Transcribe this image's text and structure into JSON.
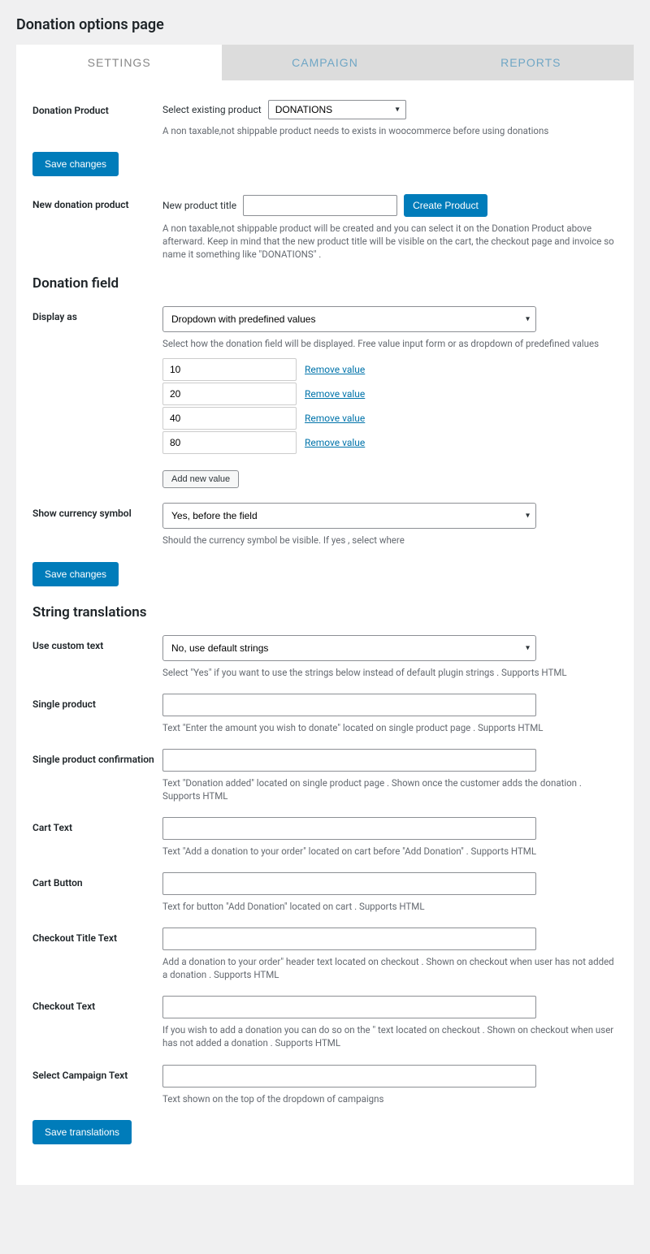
{
  "page_title": "Donation options page",
  "tabs": {
    "settings": "SETTINGS",
    "campaign": "CAMPAIGN",
    "reports": "REPORTS"
  },
  "donation_product": {
    "label": "Donation Product",
    "select_label": "Select existing product",
    "selected": "DONATIONS",
    "help": "A non taxable,not shippable product needs to exists in woocommerce before using donations"
  },
  "save_changes": "Save changes",
  "new_product": {
    "label": "New donation product",
    "title_label": "New product title",
    "value": "",
    "button": "Create Product",
    "help": "A non taxable,not shippable product will be created and you can select it on the Donation Product above afterward. Keep in mind that the new product title will be visible on the cart, the checkout page and invoice so name it something like \"DONATIONS\" ."
  },
  "donation_field_heading": "Donation field",
  "display_as": {
    "label": "Display as",
    "selected": "Dropdown with predefined values",
    "help": "Select how the donation field will be displayed. Free value input form or as dropdown of predefined values",
    "values": [
      "10",
      "20",
      "40",
      "80"
    ],
    "remove": "Remove value",
    "add_new": "Add new value"
  },
  "currency": {
    "label": "Show currency symbol",
    "selected": "Yes, before the field",
    "help": "Should the currency symbol be visible. If yes , select where"
  },
  "translations_heading": "String translations",
  "custom_text": {
    "label": "Use custom text",
    "selected": "No, use default strings",
    "help": "Select \"Yes\" if you want to use the strings below instead of default plugin strings . Supports HTML"
  },
  "single_product": {
    "label": "Single product",
    "value": "",
    "help": "Text \"Enter the amount you wish to donate\" located on single product page . Supports HTML"
  },
  "single_product_conf": {
    "label": "Single product confirmation",
    "value": "",
    "help": "Text \"Donation added\" located on single product page . Shown once the customer adds the donation . Supports HTML"
  },
  "cart_text": {
    "label": "Cart Text",
    "value": "",
    "help": "Text \"Add a donation to your order\" located on cart before \"Add Donation\" . Supports HTML"
  },
  "cart_button": {
    "label": "Cart Button",
    "value": "",
    "help": "Text for button \"Add Donation\" located on cart . Supports HTML"
  },
  "checkout_title": {
    "label": "Checkout Title Text",
    "value": "",
    "help": "Add a donation to your order\" header text located on checkout . Shown on checkout when user has not added a donation . Supports HTML"
  },
  "checkout_text": {
    "label": "Checkout Text",
    "value": "",
    "help": "If you wish to add a donation you can do so on the \" text located on checkout . Shown on checkout when user has not added a donation . Supports HTML"
  },
  "select_campaign": {
    "label": "Select Campaign Text",
    "value": "",
    "help": "Text shown on the top of the dropdown of campaigns"
  },
  "save_translations": "Save translations"
}
